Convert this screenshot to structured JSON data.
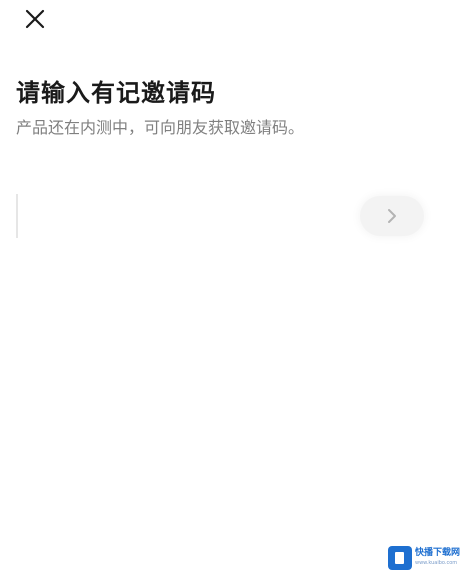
{
  "header": {
    "close_icon": "close-icon"
  },
  "page": {
    "title": "请输入有记邀请码",
    "subtitle": "产品还在内测中，可向朋友获取邀请码。"
  },
  "invite": {
    "input_value": "",
    "next_icon": "chevron-right-icon"
  },
  "watermark": {
    "text": "快播下载网",
    "sub": "www.kuaibo.com"
  },
  "colors": {
    "background": "#ffffff",
    "title": "#1a1a1a",
    "subtitle": "#808080",
    "button_bg": "#f3f3f3",
    "watermark_blue": "#1e6fd0"
  }
}
